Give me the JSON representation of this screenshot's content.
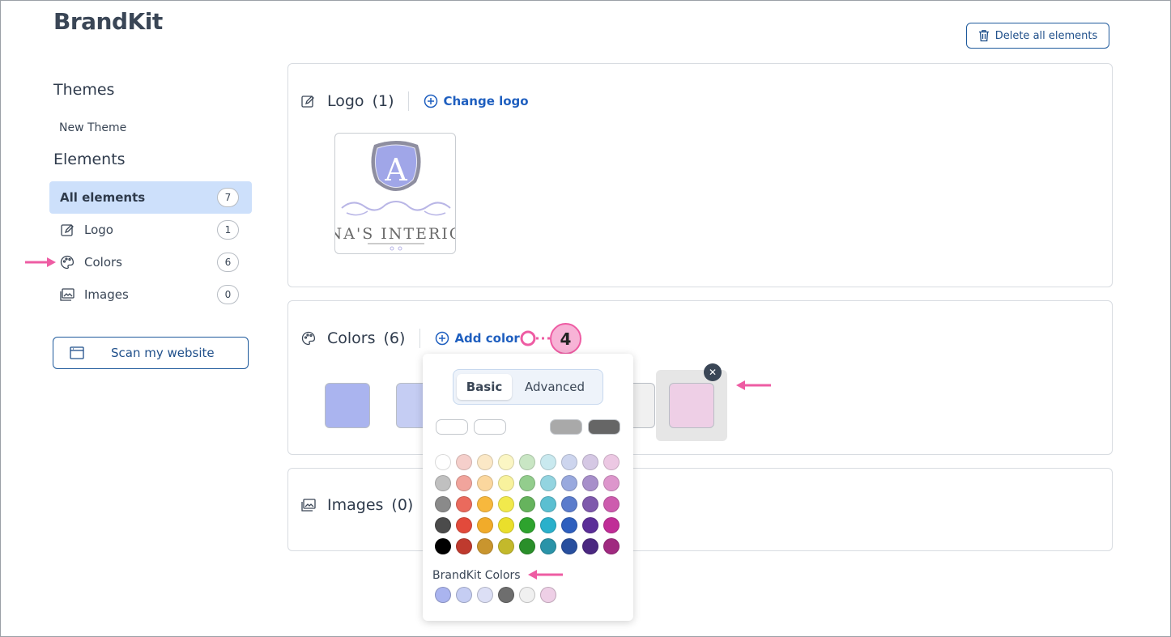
{
  "app": {
    "title": "BrandKit"
  },
  "toolbar": {
    "delete_label": "Delete all elements"
  },
  "sidebar": {
    "themes_heading": "Themes",
    "theme_item": "New Theme",
    "elements_heading": "Elements",
    "items": [
      {
        "label": "All elements",
        "count": "7",
        "icon": "none",
        "active": true
      },
      {
        "label": "Logo",
        "count": "1",
        "icon": "edit-square-icon"
      },
      {
        "label": "Colors",
        "count": "6",
        "icon": "palette-icon"
      },
      {
        "label": "Images",
        "count": "0",
        "icon": "images-icon"
      }
    ],
    "scan_label": "Scan my website"
  },
  "logo_card": {
    "title": "Logo",
    "count": "(1)",
    "action": "Change logo",
    "logo_letter": "A",
    "logo_text": "NA'S INTERIO"
  },
  "colors_card": {
    "title": "Colors",
    "count": "(6)",
    "action": "Add color",
    "swatches": [
      "#aab4ef",
      "#c5cdf3",
      "#dcdff5",
      "#6e6e6e",
      "#f0f0f0",
      "#eecfe6"
    ]
  },
  "images_card": {
    "title": "Images",
    "count": "(0)"
  },
  "picker": {
    "tabs": {
      "basic": "Basic",
      "advanced": "Advanced"
    },
    "grays": [
      "#ffffff",
      "#ffffff",
      "#ffffff",
      "#a9a9a9",
      "#666666"
    ],
    "palette": [
      [
        "#ffffff",
        "#f5cfcb",
        "#fbe8c6",
        "#fbf6c4",
        "#c9e6c4",
        "#c9e9ef",
        "#cdd5ee",
        "#d5c8e4",
        "#ecc8e3"
      ],
      [
        "#c0c0c0",
        "#f1a49c",
        "#fbd79e",
        "#f8f29d",
        "#93cd8d",
        "#93d4e0",
        "#99a9de",
        "#a78fca",
        "#dd96cc"
      ],
      [
        "#8a8a8a",
        "#ea6a5d",
        "#f7b83d",
        "#f1e94c",
        "#66b35d",
        "#5bbfd1",
        "#5b7ccc",
        "#7e59ac",
        "#cd5cae"
      ],
      [
        "#4b4b4b",
        "#e24a3b",
        "#f1ab2a",
        "#eadf2b",
        "#2ea32e",
        "#2ab0cb",
        "#2e5fbe",
        "#5b2e98",
        "#c02d97"
      ],
      [
        "#000000",
        "#bf3a2e",
        "#c9952e",
        "#c3b92b",
        "#2a8f2a",
        "#2a93a8",
        "#284f9e",
        "#4a2780",
        "#a02a80"
      ]
    ],
    "brandkit_label": "BrandKit Colors",
    "brandkit_colors": [
      "#aab4ef",
      "#c5cdf3",
      "#dcdff5",
      "#6e6e6e",
      "#f0f0f0",
      "#eecfe6"
    ]
  },
  "annotation": {
    "step": "4"
  },
  "colors": {
    "accent": "#1f5fbf",
    "annotation": "#ee5ca3"
  }
}
